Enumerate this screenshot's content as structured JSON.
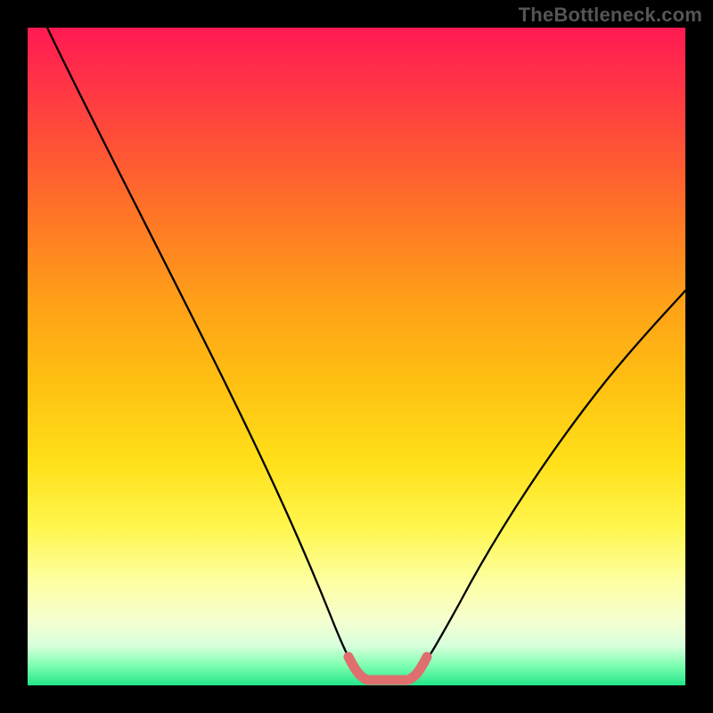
{
  "watermark": "TheBottleneck.com",
  "chart_data": {
    "type": "line",
    "title": "",
    "xlabel": "",
    "ylabel": "",
    "xlim": [
      0,
      100
    ],
    "ylim": [
      0,
      100
    ],
    "series": [
      {
        "name": "bottleneck-curve",
        "x": [
          3,
          10,
          20,
          30,
          40,
          47,
          50,
          53,
          56,
          60,
          65,
          70,
          80,
          90,
          100
        ],
        "values": [
          100,
          86,
          67,
          48,
          29,
          10,
          2,
          0.5,
          0.5,
          2,
          10,
          20,
          37,
          50,
          61
        ],
        "color": "#000000"
      },
      {
        "name": "optimal-band",
        "x": [
          49,
          50,
          52,
          54,
          56,
          58,
          59
        ],
        "values": [
          3.5,
          1.2,
          0.6,
          0.5,
          0.6,
          1.2,
          3.5
        ],
        "color": "#e07070"
      }
    ],
    "gradient_stops": [
      {
        "pos": 0,
        "color": "#ff1a52"
      },
      {
        "pos": 8,
        "color": "#ff3247"
      },
      {
        "pos": 18,
        "color": "#ff5236"
      },
      {
        "pos": 30,
        "color": "#ff7a24"
      },
      {
        "pos": 42,
        "color": "#ffa118"
      },
      {
        "pos": 54,
        "color": "#ffc012"
      },
      {
        "pos": 66,
        "color": "#ffe019"
      },
      {
        "pos": 76,
        "color": "#fff64e"
      },
      {
        "pos": 84,
        "color": "#fdffa0"
      },
      {
        "pos": 90,
        "color": "#f6ffcf"
      },
      {
        "pos": 94,
        "color": "#d8ffdc"
      },
      {
        "pos": 97,
        "color": "#7dffb0"
      },
      {
        "pos": 100,
        "color": "#23e58a"
      }
    ]
  }
}
